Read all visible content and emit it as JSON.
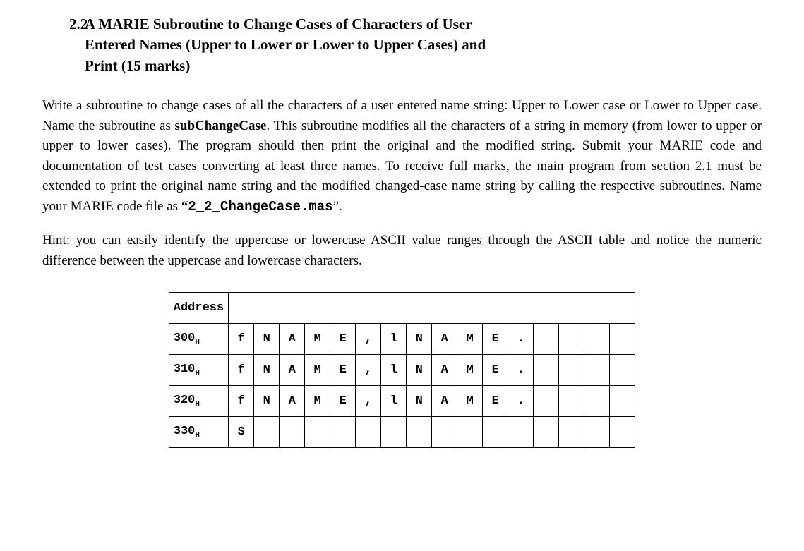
{
  "section": {
    "number": "2.2",
    "title_line1": "A MARIE Subroutine to Change Cases of Characters of User",
    "title_line2": "Entered Names (Upper to Lower or Lower to Upper Cases) and",
    "title_line3": "Print (15 marks)"
  },
  "p1a": "Write a subroutine to change cases of all the characters of a user entered name string: Upper to Lower case or Lower to Upper case. Name the subroutine as ",
  "p1_b1": "subChangeCase",
  "p1b": ". This subroutine modifies all the characters of a string in memory (from lower to upper or upper to lower cases). The program should then print the original and the modified string. Submit your MARIE code and documentation of test cases converting at least three names. To receive full marks, the main program from section 2.1 must be extended to print the original name string and the modified changed-case name string by calling the respective subroutines. Name your MARIE code file as ",
  "p1_b2a": "“",
  "p1_b2": "2_2_ChangeCase.mas",
  "p1c": "”.",
  "p2": "Hint: you can easily identify the uppercase or lowercase ASCII value ranges through the ASCII table and notice the numeric difference between the uppercase and lowercase characters.",
  "table": {
    "header": "Address",
    "rows": [
      {
        "addr": "300",
        "sub": "H",
        "cells": [
          "f",
          "N",
          "A",
          "M",
          "E",
          ",",
          "l",
          "N",
          "A",
          "M",
          "E",
          ".",
          "",
          "",
          "",
          ""
        ]
      },
      {
        "addr": "310",
        "sub": "H",
        "cells": [
          "f",
          "N",
          "A",
          "M",
          "E",
          ",",
          "l",
          "N",
          "A",
          "M",
          "E",
          ".",
          "",
          "",
          "",
          ""
        ]
      },
      {
        "addr": "320",
        "sub": "H",
        "cells": [
          "f",
          "N",
          "A",
          "M",
          "E",
          ",",
          "l",
          "N",
          "A",
          "M",
          "E",
          ".",
          "",
          "",
          "",
          ""
        ]
      },
      {
        "addr": "330",
        "sub": "H",
        "cells": [
          "$",
          "",
          "",
          "",
          "",
          "",
          "",
          "",
          "",
          "",
          "",
          "",
          "",
          "",
          "",
          ""
        ]
      }
    ]
  }
}
